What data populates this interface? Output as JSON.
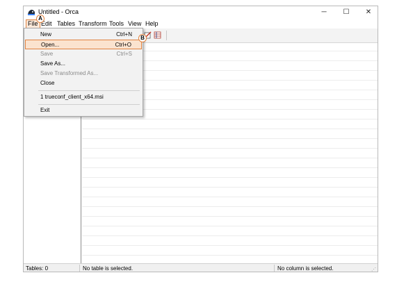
{
  "window": {
    "title": "Untitled - Orca",
    "minimize": "─",
    "maximize": "☐",
    "close": "✕"
  },
  "menubar": {
    "file": "File",
    "edit": "Edit",
    "tables": "Tables",
    "transform": "Transform",
    "tools": "Tools",
    "view": "View",
    "help": "Help"
  },
  "file_menu": {
    "items": [
      {
        "label": "New",
        "shortcut": "Ctrl+N",
        "enabled": true
      },
      {
        "label": "Open...",
        "shortcut": "Ctrl+O",
        "enabled": true,
        "highlighted": true
      },
      {
        "label": "Save",
        "shortcut": "Ctrl+S",
        "enabled": false
      },
      {
        "label": "Save As...",
        "shortcut": "",
        "enabled": true
      },
      {
        "label": "Save Transformed As...",
        "shortcut": "",
        "enabled": false
      },
      {
        "label": "Close",
        "shortcut": "",
        "enabled": true
      },
      {
        "label": "1 trueconf_client_x64.msi",
        "shortcut": "",
        "enabled": true
      },
      {
        "label": "Exit",
        "shortcut": "",
        "enabled": true
      }
    ]
  },
  "annotations": {
    "a": "A",
    "b": "B"
  },
  "statusbar": {
    "tables": "Tables: 0",
    "table_status": "No table is selected.",
    "column_status": "No column is selected."
  },
  "colors": {
    "accent": "#e0823f",
    "highlight_bg": "#fbe3cf"
  },
  "icons": [
    "orca-app-icon",
    "edit-table-icon",
    "grid-table-icon"
  ]
}
